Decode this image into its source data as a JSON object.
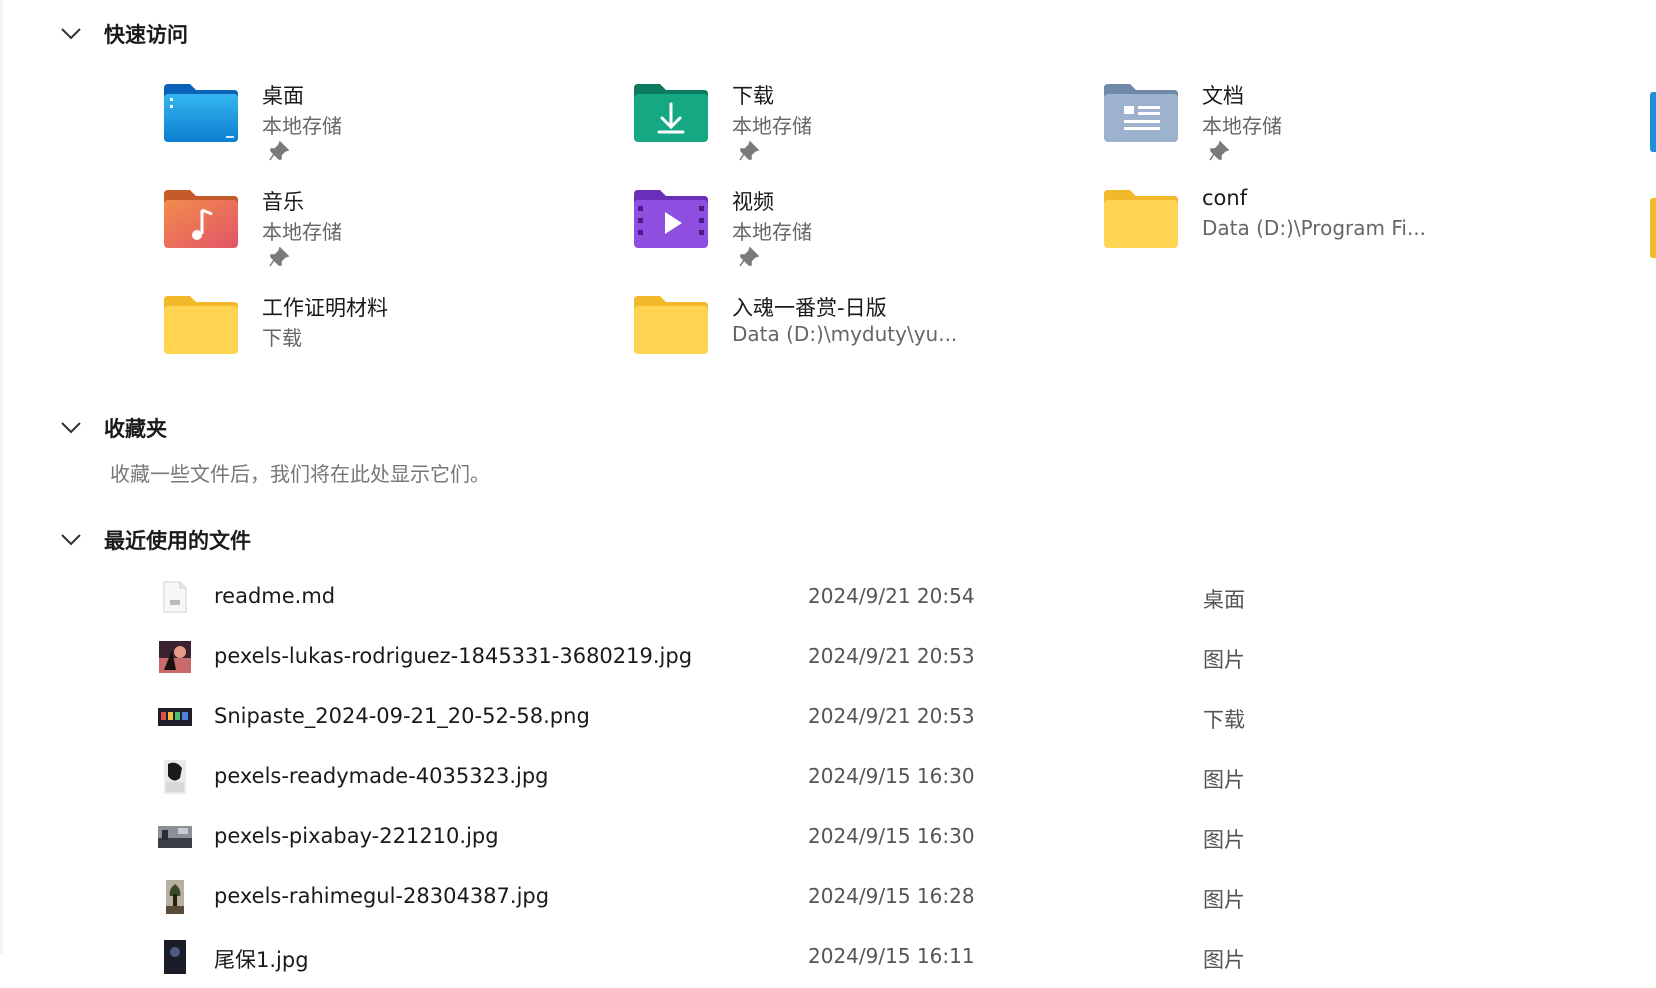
{
  "sections": {
    "quick_access": "快速访问",
    "favorites": "收藏夹",
    "recent": "最近使用的文件"
  },
  "quick_access": [
    {
      "name": "桌面",
      "sub": "本地存储",
      "icon": "desktop-folder-icon",
      "pinned": true
    },
    {
      "name": "下载",
      "sub": "本地存储",
      "icon": "downloads-folder-icon",
      "pinned": true
    },
    {
      "name": "文档",
      "sub": "本地存储",
      "icon": "documents-folder-icon",
      "pinned": true
    },
    {
      "name": "音乐",
      "sub": "本地存储",
      "icon": "music-folder-icon",
      "pinned": true
    },
    {
      "name": "视频",
      "sub": "本地存储",
      "icon": "videos-folder-icon",
      "pinned": true
    },
    {
      "name": "conf",
      "sub": "Data (D:)\\Program Fi...",
      "icon": "folder-icon",
      "pinned": false
    },
    {
      "name": "工作证明材料",
      "sub": "下载",
      "icon": "folder-icon",
      "pinned": false
    },
    {
      "name": "入魂一番赏-日版",
      "sub": "Data (D:)\\myduty\\yu...",
      "icon": "folder-icon",
      "pinned": false
    }
  ],
  "favorites_empty": "收藏一些文件后，我们将在此处显示它们。",
  "recent_files": [
    {
      "name": "readme.md",
      "date": "2024/9/21 20:54",
      "location": "桌面"
    },
    {
      "name": "pexels-lukas-rodriguez-1845331-3680219.jpg",
      "date": "2024/9/21 20:53",
      "location": "图片"
    },
    {
      "name": "Snipaste_2024-09-21_20-52-58.png",
      "date": "2024/9/21 20:53",
      "location": "下载"
    },
    {
      "name": "pexels-readymade-4035323.jpg",
      "date": "2024/9/15 16:30",
      "location": "图片"
    },
    {
      "name": "pexels-pixabay-221210.jpg",
      "date": "2024/9/15 16:30",
      "location": "图片"
    },
    {
      "name": "pexels-rahimegul-28304387.jpg",
      "date": "2024/9/15 16:28",
      "location": "图片"
    },
    {
      "name": "尾保1.jpg",
      "date": "2024/9/15 16:11",
      "location": "图片"
    }
  ],
  "colors": {
    "accent": "#0067c0",
    "folder_yellow": "#ffd04d"
  }
}
